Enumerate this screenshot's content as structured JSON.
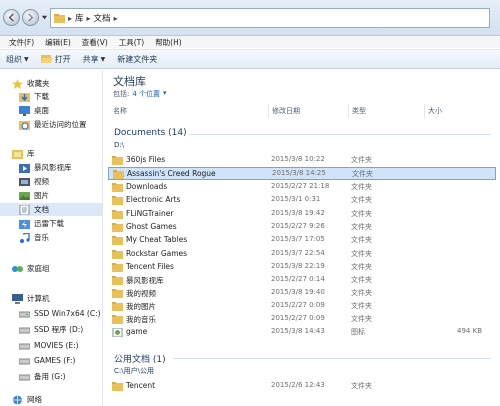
{
  "address": {
    "segments": [
      "库",
      "文档"
    ]
  },
  "menu": [
    "文件(F)",
    "编辑(E)",
    "查看(V)",
    "工具(T)",
    "帮助(H)"
  ],
  "toolbar": {
    "organize": "组织",
    "open": "打开",
    "share": "共享",
    "new_folder": "新建文件夹"
  },
  "nav": {
    "favorites": "收藏夹",
    "downloads": "下载",
    "desktop": "桌面",
    "recent": "最近访问的位置",
    "libraries": "库",
    "baofeng": "暴风影视库",
    "videos": "视频",
    "pictures": "图片",
    "documents": "文档",
    "thunder": "迅雷下载",
    "music": "音乐",
    "homegroup": "家庭组",
    "computer": "计算机",
    "drive_c": "SSD Win7x64 (C:)",
    "drive_d": "SSD 程序 (D:)",
    "drive_e": "MOVIES (E:)",
    "drive_f": "GAMES (F:)",
    "drive_g": "备用 (G:)",
    "network": "网络"
  },
  "library": {
    "title": "文档库",
    "includes_prefix": "包括:",
    "includes_link": "4 个位置"
  },
  "columns": {
    "name": "名称",
    "date": "修改日期",
    "type": "类型",
    "size": "大小"
  },
  "groups": [
    {
      "title": "Documents (14)",
      "path": "D:\\",
      "items": [
        {
          "name": "360js Files",
          "date": "2015/3/8 10:22",
          "type": "文件夹",
          "size": "",
          "icon": "folder-icon"
        },
        {
          "name": "Assassin's Creed Rogue",
          "date": "2015/3/8 14:25",
          "type": "文件夹",
          "size": "",
          "icon": "folder-icon",
          "selected": true
        },
        {
          "name": "Downloads",
          "date": "2015/2/27 21:18",
          "type": "文件夹",
          "size": "",
          "icon": "folder-icon"
        },
        {
          "name": "Electronic Arts",
          "date": "2015/3/1 0:31",
          "type": "文件夹",
          "size": "",
          "icon": "folder-icon"
        },
        {
          "name": "FLiNGTrainer",
          "date": "2015/3/8 19:42",
          "type": "文件夹",
          "size": "",
          "icon": "folder-icon"
        },
        {
          "name": "Ghost Games",
          "date": "2015/2/27 9:26",
          "type": "文件夹",
          "size": "",
          "icon": "folder-icon"
        },
        {
          "name": "My Cheat Tables",
          "date": "2015/3/7 17:05",
          "type": "文件夹",
          "size": "",
          "icon": "folder-icon"
        },
        {
          "name": "Rockstar Games",
          "date": "2015/3/7 22:54",
          "type": "文件夹",
          "size": "",
          "icon": "folder-icon"
        },
        {
          "name": "Tencent Files",
          "date": "2015/3/8 22:19",
          "type": "文件夹",
          "size": "",
          "icon": "folder-icon"
        },
        {
          "name": "暴风影视库",
          "date": "2015/2/27 0:14",
          "type": "文件夹",
          "size": "",
          "icon": "folder-icon"
        },
        {
          "name": "我的视频",
          "date": "2015/3/8 19:40",
          "type": "文件夹",
          "size": "",
          "icon": "folder-icon"
        },
        {
          "name": "我的图片",
          "date": "2015/2/27 0:09",
          "type": "文件夹",
          "size": "",
          "icon": "folder-icon"
        },
        {
          "name": "我的音乐",
          "date": "2015/2/27 0:09",
          "type": "文件夹",
          "size": "",
          "icon": "folder-icon"
        },
        {
          "name": "game",
          "date": "2015/3/8 14:43",
          "type": "图标",
          "size": "494 KB",
          "icon": "image-file-icon"
        }
      ]
    },
    {
      "title": "公用文档 (1)",
      "path": "C:\\用户\\公用",
      "items": [
        {
          "name": "Tencent",
          "date": "2015/2/6 12:43",
          "type": "文件夹",
          "size": "",
          "icon": "folder-icon"
        }
      ]
    }
  ],
  "colors": {
    "title": "#1e395b",
    "group": "#1e3b6e",
    "selection": "#cfe3fa",
    "folder": "#e8c15a"
  }
}
